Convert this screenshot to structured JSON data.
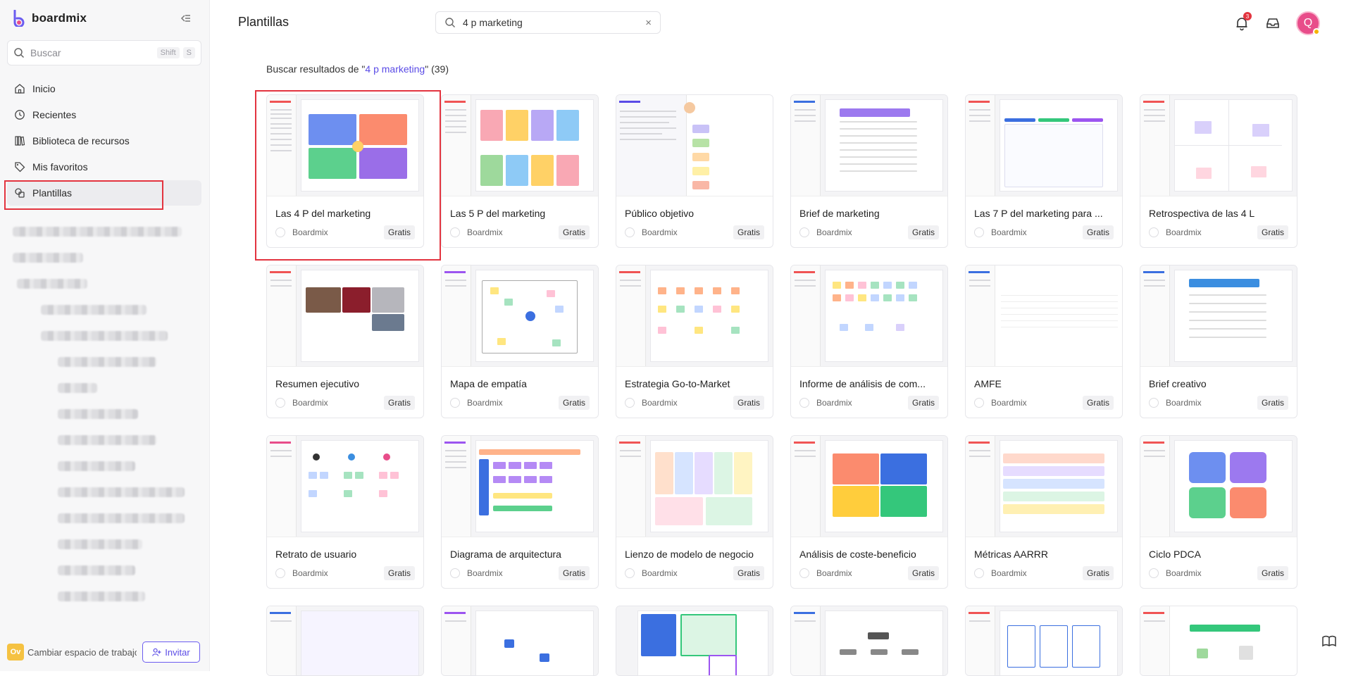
{
  "app": {
    "name": "boardmix"
  },
  "sidebar": {
    "search_placeholder": "Buscar",
    "shortcut_keys": [
      "Shift",
      "S"
    ],
    "items": [
      {
        "label": "Inicio",
        "icon": "home-icon"
      },
      {
        "label": "Recientes",
        "icon": "clock-icon"
      },
      {
        "label": "Biblioteca de recursos",
        "icon": "library-icon"
      },
      {
        "label": "Mis favoritos",
        "icon": "tag-icon"
      },
      {
        "label": "Plantillas",
        "icon": "templates-icon",
        "active": true
      }
    ],
    "workspace_badge": "Ov",
    "workspace_label": "Cambiar espacio de trabajo",
    "invite_label": "Invitar"
  },
  "header": {
    "title": "Plantillas",
    "search_value": "4 p marketing",
    "notification_count": "3",
    "avatar_letter": "Q"
  },
  "results": {
    "prefix": "Buscar resultados de \"",
    "query": "4 p marketing",
    "suffix": "\" (39)"
  },
  "colors": {
    "accent": "#5a4be6",
    "highlight": "#e3343f",
    "avatar": "#e84d8a"
  },
  "cards": [
    {
      "title": "Las 4 P del marketing",
      "author": "Boardmix",
      "badge": "Gratis"
    },
    {
      "title": "Las 5 P del marketing",
      "author": "Boardmix",
      "badge": "Gratis"
    },
    {
      "title": "Público objetivo",
      "author": "Boardmix",
      "badge": "Gratis"
    },
    {
      "title": "Brief de marketing",
      "author": "Boardmix",
      "badge": "Gratis"
    },
    {
      "title": "Las 7 P del marketing para ...",
      "author": "Boardmix",
      "badge": "Gratis"
    },
    {
      "title": "Retrospectiva de las 4 L",
      "author": "Boardmix",
      "badge": "Gratis"
    },
    {
      "title": "Resumen ejecutivo",
      "author": "Boardmix",
      "badge": "Gratis"
    },
    {
      "title": "Mapa de empatía",
      "author": "Boardmix",
      "badge": "Gratis"
    },
    {
      "title": "Estrategia Go-to-Market",
      "author": "Boardmix",
      "badge": "Gratis"
    },
    {
      "title": "Informe de análisis de com...",
      "author": "Boardmix",
      "badge": "Gratis"
    },
    {
      "title": "AMFE",
      "author": "Boardmix",
      "badge": "Gratis"
    },
    {
      "title": "Brief creativo",
      "author": "Boardmix",
      "badge": "Gratis"
    },
    {
      "title": "Retrato de usuario",
      "author": "Boardmix",
      "badge": "Gratis"
    },
    {
      "title": "Diagrama de arquitectura",
      "author": "Boardmix",
      "badge": "Gratis"
    },
    {
      "title": "Lienzo de modelo de negocio",
      "author": "Boardmix",
      "badge": "Gratis"
    },
    {
      "title": "Análisis de coste-beneficio",
      "author": "Boardmix",
      "badge": "Gratis"
    },
    {
      "title": "Métricas AARRR",
      "author": "Boardmix",
      "badge": "Gratis"
    },
    {
      "title": "Ciclo PDCA",
      "author": "Boardmix",
      "badge": "Gratis"
    }
  ]
}
